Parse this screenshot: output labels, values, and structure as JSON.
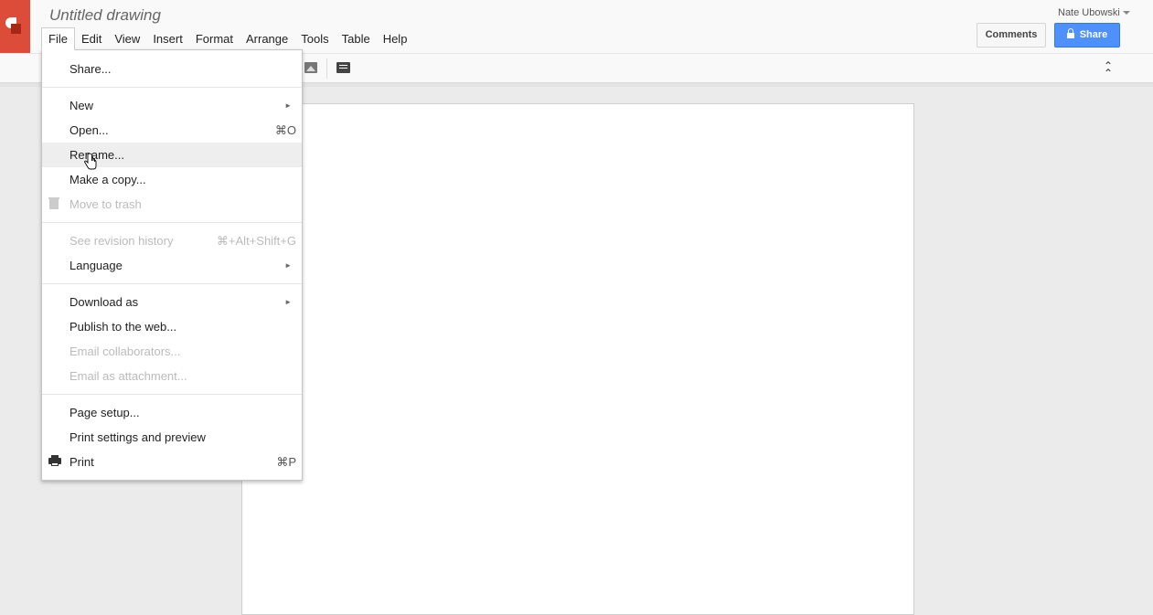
{
  "app": {
    "title": "Untitled drawing",
    "user": "Nate Ubowski"
  },
  "menubar": {
    "items": [
      "File",
      "Edit",
      "View",
      "Insert",
      "Format",
      "Arrange",
      "Tools",
      "Table",
      "Help"
    ]
  },
  "buttons": {
    "comments": "Comments",
    "share": "Share"
  },
  "file_menu": {
    "share": "Share...",
    "new": "New",
    "open": "Open...",
    "open_shortcut": "⌘O",
    "rename": "Rename...",
    "make_copy": "Make a copy...",
    "move_to_trash": "Move to trash",
    "see_revision_history": "See revision history",
    "revision_shortcut": "⌘+Alt+Shift+G",
    "language": "Language",
    "download_as": "Download as",
    "publish": "Publish to the web...",
    "email_collaborators": "Email collaborators...",
    "email_attachment": "Email as attachment...",
    "page_setup": "Page setup...",
    "print_settings": "Print settings and preview",
    "print": "Print",
    "print_shortcut": "⌘P"
  },
  "icons": {
    "toolbar": [
      "image-icon",
      "comment-icon",
      "collapse-toolbar-icon"
    ],
    "menu": [
      "trash-icon",
      "print-icon",
      "submenu-arrow-icon"
    ]
  },
  "colors": {
    "brand": "#dd4b39",
    "share_button": "#4d90fe"
  }
}
